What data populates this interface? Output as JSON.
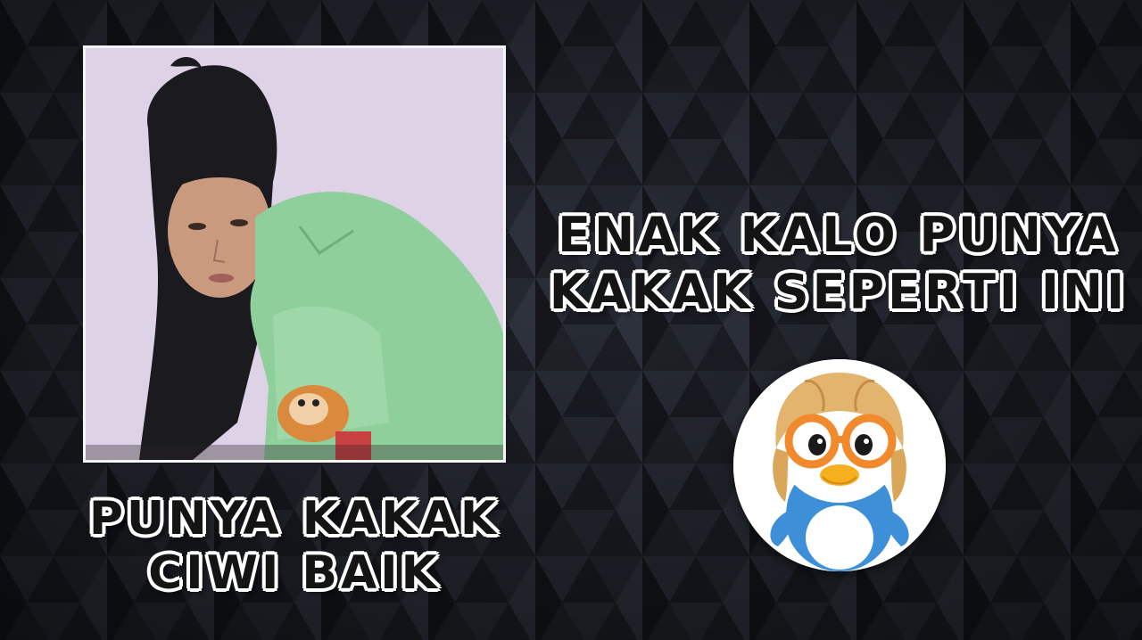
{
  "caption_right": {
    "line1": "ENAK KALO PUNYA",
    "line2": "KAKAK SEPERTI INI"
  },
  "caption_left": {
    "line1": "PUNYA KAKAK",
    "line2": "CIWI BAIK"
  },
  "colors": {
    "background": "#1b1e25",
    "text_fill": "#141414",
    "text_outline": "#ffffff",
    "photo_wall": "#d9cde3",
    "shirt": "#8fcf9c"
  },
  "images": {
    "photo": "girl-in-green-shirt-photo",
    "mascot": "penguin-mascot-with-aviator-cap-and-orange-goggles"
  }
}
